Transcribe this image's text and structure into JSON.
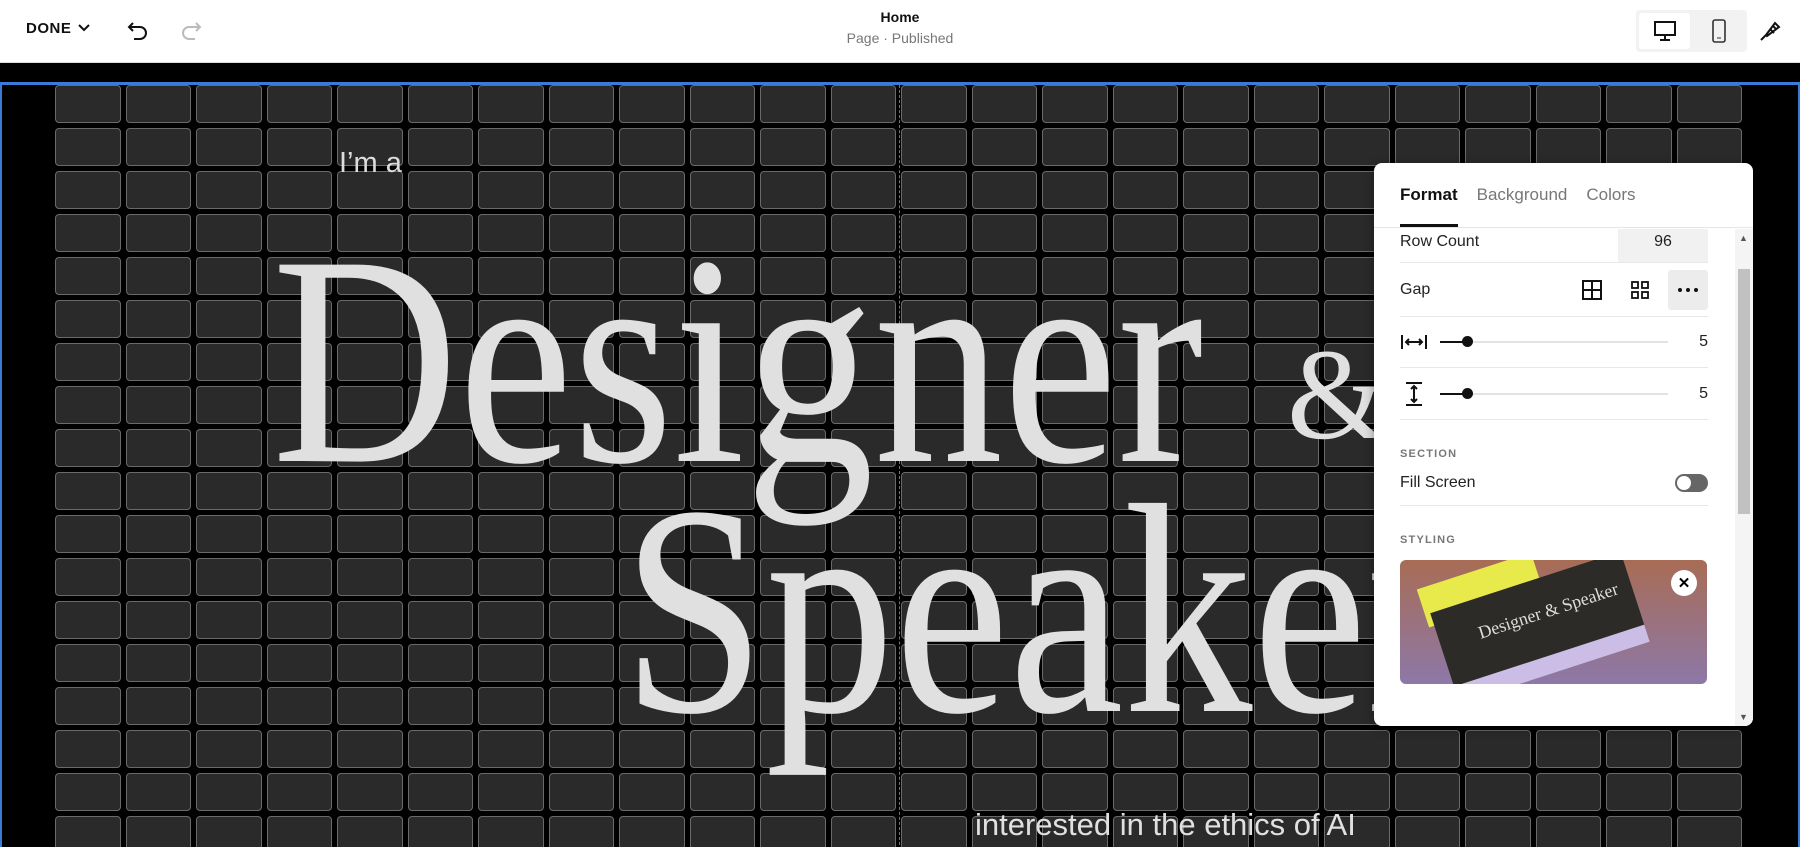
{
  "topbar": {
    "done_label": "DONE",
    "title": "Home",
    "subtitle": "Page · Published"
  },
  "hero": {
    "pre": "I’m a",
    "line1": "Designer",
    "amp": "&",
    "line2": "Speaker",
    "post": "interested in the ethics of AI"
  },
  "panel": {
    "tabs": [
      {
        "label": "Format"
      },
      {
        "label": "Background"
      },
      {
        "label": "Colors"
      }
    ],
    "row_count_label": "Row Count",
    "row_count_value": "96",
    "gap_label": "Gap",
    "h_gap_value": "5",
    "v_gap_value": "5",
    "section_heading": "SECTION",
    "fill_screen_label": "Fill Screen",
    "styling_heading": "STYLING",
    "thumb_text": "Designer & Speaker"
  },
  "colors": {
    "accent": "#3b7bd8"
  }
}
